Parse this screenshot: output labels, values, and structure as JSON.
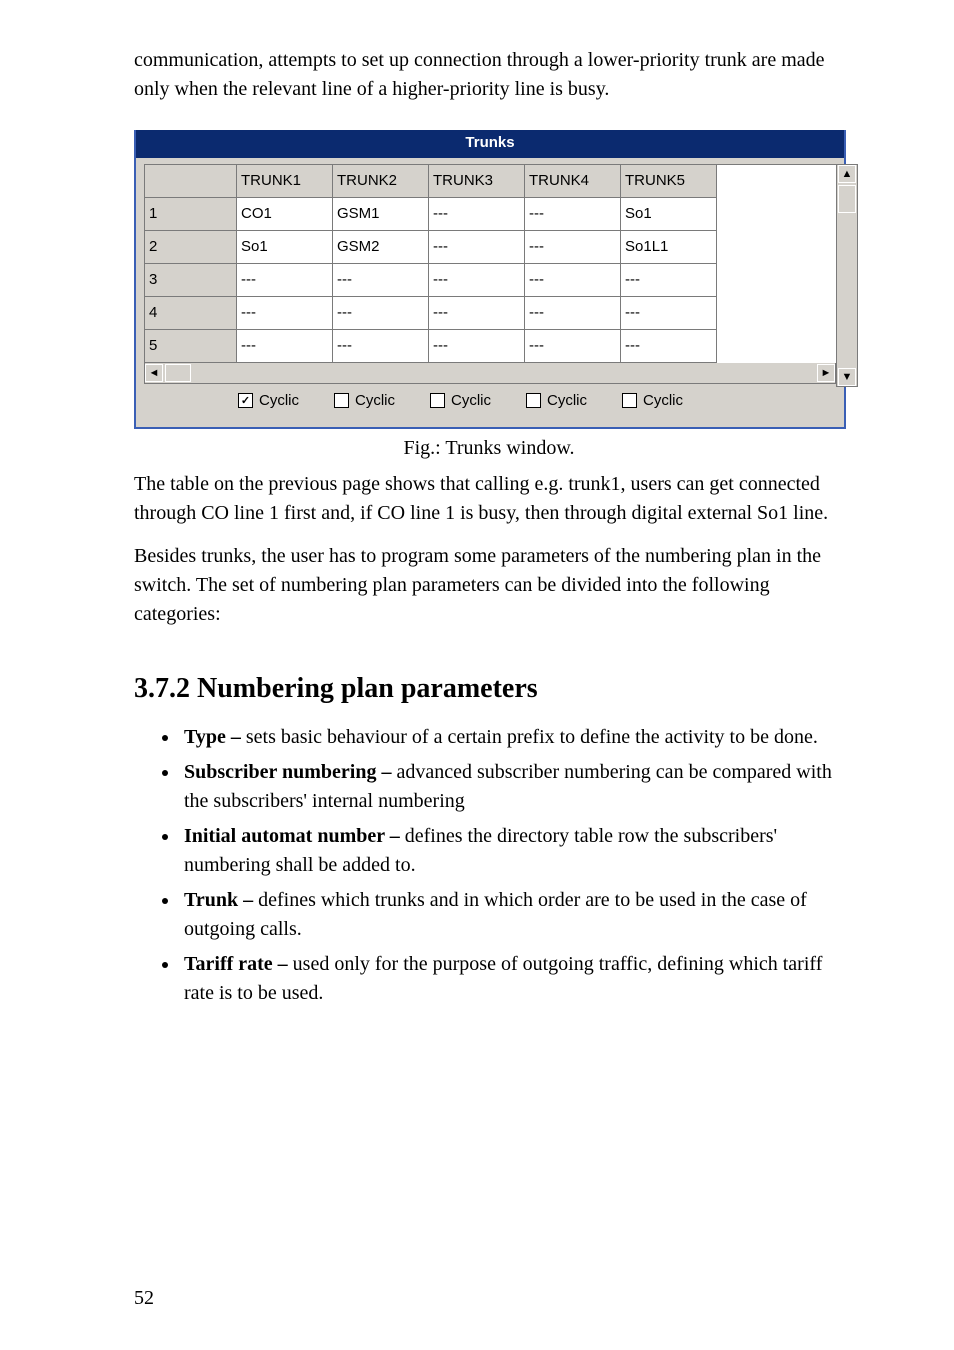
{
  "intro_text": "communication, attempts to set up connection through a lower-priority trunk are made only when the relevant line of a higher-priority line is busy.",
  "panel_title": "Trunks",
  "columns": [
    "TRUNK1",
    "TRUNK2",
    "TRUNK3",
    "TRUNK4",
    "TRUNK5"
  ],
  "rows": [
    {
      "n": "1",
      "cells": [
        "CO1",
        "GSM1",
        "---",
        "---",
        "So1"
      ]
    },
    {
      "n": "2",
      "cells": [
        "So1",
        "GSM2",
        "---",
        "---",
        "So1L1"
      ]
    },
    {
      "n": "3",
      "cells": [
        "---",
        "---",
        "---",
        "---",
        "---"
      ]
    },
    {
      "n": "4",
      "cells": [
        "---",
        "---",
        "---",
        "---",
        "---"
      ]
    },
    {
      "n": "5",
      "cells": [
        "---",
        "---",
        "---",
        "---",
        "---"
      ]
    }
  ],
  "cyclic": {
    "label": "Cyclic",
    "values": [
      true,
      false,
      false,
      false,
      false
    ]
  },
  "caption": "Fig.: Trunks window.",
  "para1": "The table on the previous page shows that calling e.g. trunk1, users can get connected through CO line 1 first and, if CO line 1 is busy, then through digital external So1 line.",
  "para2": "Besides trunks, the user has to program some parameters of the numbering plan in the switch. The set of numbering plan parameters can be divided into the following categories:",
  "section_heading": "3.7.2 Numbering plan parameters",
  "bullets": [
    {
      "b": "Type –",
      "t": " sets basic behaviour of a certain prefix to define the activity to be done."
    },
    {
      "b": "Subscriber numbering –",
      "t": " advanced subscriber numbering can be compared with the subscribers' internal numbering"
    },
    {
      "b": "Initial automat number –",
      "t": " defines the directory table row the subscribers' numbering shall be added to."
    },
    {
      "b": "Trunk –",
      "t": " defines which trunks and in which order are to be used in the case of outgoing calls."
    },
    {
      "b": "Tariff rate –",
      "t": " used only for the purpose of outgoing traffic, defining which tariff rate is to be used."
    }
  ],
  "page_number": "52"
}
